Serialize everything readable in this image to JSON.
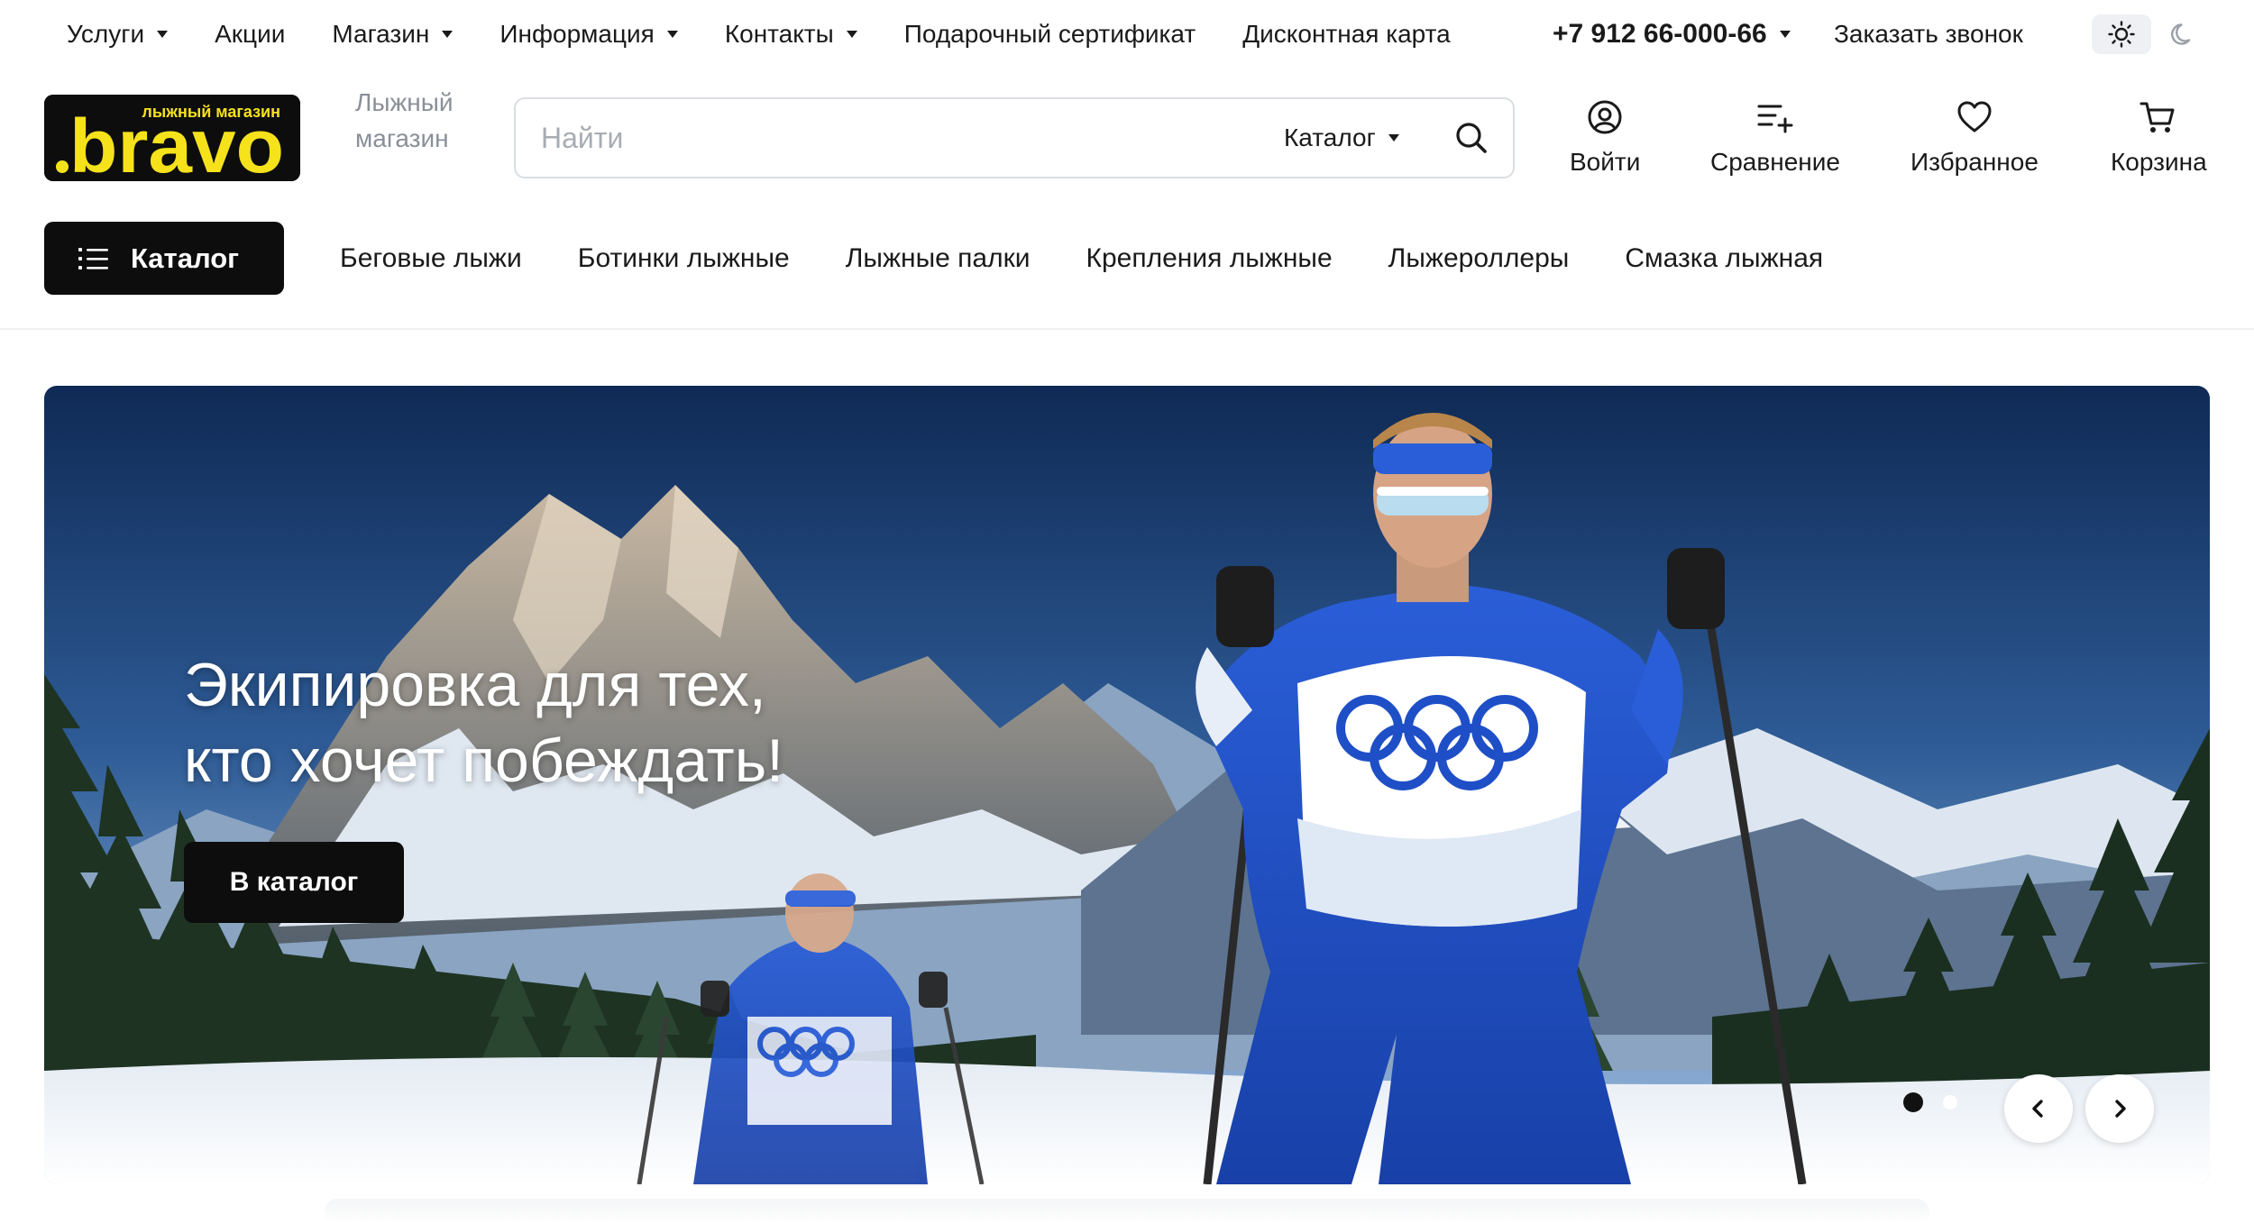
{
  "topnav": {
    "items": [
      {
        "label": "Услуги",
        "dropdown": true
      },
      {
        "label": "Акции",
        "dropdown": false
      },
      {
        "label": "Магазин",
        "dropdown": true
      },
      {
        "label": "Информация",
        "dropdown": true
      },
      {
        "label": "Контакты",
        "dropdown": true
      },
      {
        "label": "Подарочный сертификат",
        "dropdown": false
      },
      {
        "label": "Дисконтная карта",
        "dropdown": false
      }
    ],
    "phone": "+7 912 66-000-66",
    "callback_label": "Заказать звонок",
    "theme_icons": [
      "sun-icon",
      "moon-icon"
    ]
  },
  "header": {
    "logo_text": "bravo",
    "logo_subtext": "лыжный магазин",
    "logo_colors": {
      "background": "#0d0d0d",
      "text": "#f5e21b"
    },
    "tagline": "Лыжный магазин",
    "search": {
      "placeholder": "Найти",
      "value": "",
      "scope_label": "Каталог"
    },
    "actions": [
      {
        "label": "Войти",
        "icon": "user-icon"
      },
      {
        "label": "Сравнение",
        "icon": "compare-icon"
      },
      {
        "label": "Избранное",
        "icon": "heart-icon"
      },
      {
        "label": "Корзина",
        "icon": "cart-icon"
      }
    ]
  },
  "catalog": {
    "button_label": "Каталог",
    "items": [
      "Беговые лыжи",
      "Ботинки лыжные",
      "Лыжные палки",
      "Крепления лыжные",
      "Лыжероллеры",
      "Смазка лыжная"
    ]
  },
  "hero": {
    "title_line1": "Экипировка для тех,",
    "title_line2": "кто хочет побеждать!",
    "cta_label": "В каталог",
    "slides_total": 2,
    "active_slide": 1
  },
  "colors": {
    "accent": "#0d0d0d",
    "brand_yellow": "#f5e21b",
    "sky_top": "#12305c",
    "suit_blue": "#1f4fc7"
  }
}
